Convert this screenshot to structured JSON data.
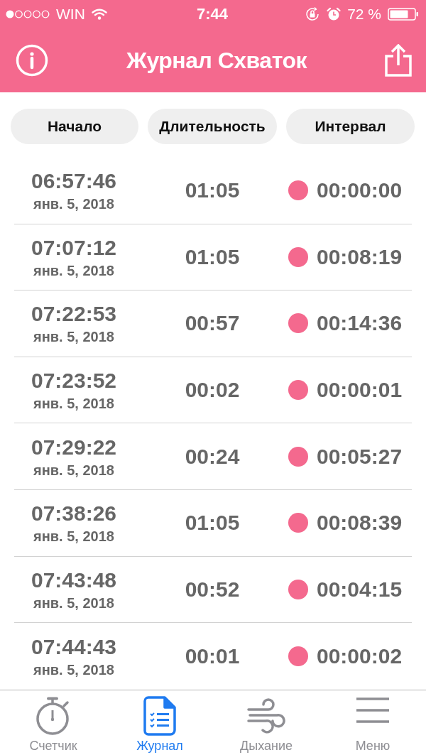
{
  "status_bar": {
    "carrier": "WIN",
    "time": "7:44",
    "battery": "72 %"
  },
  "nav_bar": {
    "title": "Журнал Схваток"
  },
  "columns": [
    "Начало",
    "Длительность",
    "Интервал"
  ],
  "rows": [
    {
      "start_time": "06:57:46",
      "start_date": "янв. 5, 2018",
      "duration": "01:05",
      "interval": "00:00:00"
    },
    {
      "start_time": "07:07:12",
      "start_date": "янв. 5, 2018",
      "duration": "01:05",
      "interval": "00:08:19"
    },
    {
      "start_time": "07:22:53",
      "start_date": "янв. 5, 2018",
      "duration": "00:57",
      "interval": "00:14:36"
    },
    {
      "start_time": "07:23:52",
      "start_date": "янв. 5, 2018",
      "duration": "00:02",
      "interval": "00:00:01"
    },
    {
      "start_time": "07:29:22",
      "start_date": "янв. 5, 2018",
      "duration": "00:24",
      "interval": "00:05:27"
    },
    {
      "start_time": "07:38:26",
      "start_date": "янв. 5, 2018",
      "duration": "01:05",
      "interval": "00:08:39"
    },
    {
      "start_time": "07:43:48",
      "start_date": "янв. 5, 2018",
      "duration": "00:52",
      "interval": "00:04:15"
    },
    {
      "start_time": "07:44:43",
      "start_date": "янв. 5, 2018",
      "duration": "00:01",
      "interval": "00:00:02"
    }
  ],
  "tab_bar": [
    {
      "label": "Счетчик",
      "kind": "stopwatch",
      "selected": false
    },
    {
      "label": "Журнал",
      "kind": "journal",
      "selected": true
    },
    {
      "label": "Дыхание",
      "kind": "breathing",
      "selected": false
    },
    {
      "label": "Меню",
      "kind": "menu",
      "selected": false
    }
  ]
}
